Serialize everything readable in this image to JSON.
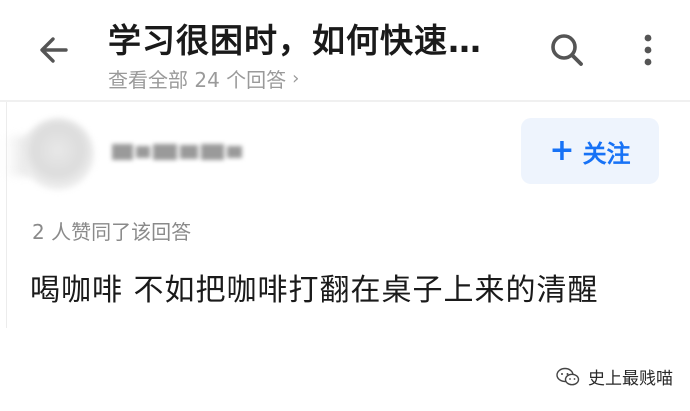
{
  "header": {
    "back_icon": "arrow-left-icon",
    "title": "学习很困时，如何快速…",
    "subtitle": "查看全部 24 个回答",
    "subtitle_chevron": "chevron-right-icon",
    "search_icon": "search-icon",
    "more_icon": "more-vertical-icon"
  },
  "author": {
    "avatar_icon": "avatar-blurred",
    "follow_label": "关注",
    "follow_icon": "plus-icon"
  },
  "answer": {
    "likes_text": "2 人赞同了该回答",
    "content": "喝咖啡 不如把咖啡打翻在桌子上来的清醒"
  },
  "watermark": {
    "icon": "wechat-icon",
    "text": "史上最贱喵"
  },
  "colors": {
    "accent": "#1772f6",
    "follow_bg": "#eef4fd",
    "muted_text": "#9a9a9a",
    "primary_text": "#1a1a1a"
  }
}
